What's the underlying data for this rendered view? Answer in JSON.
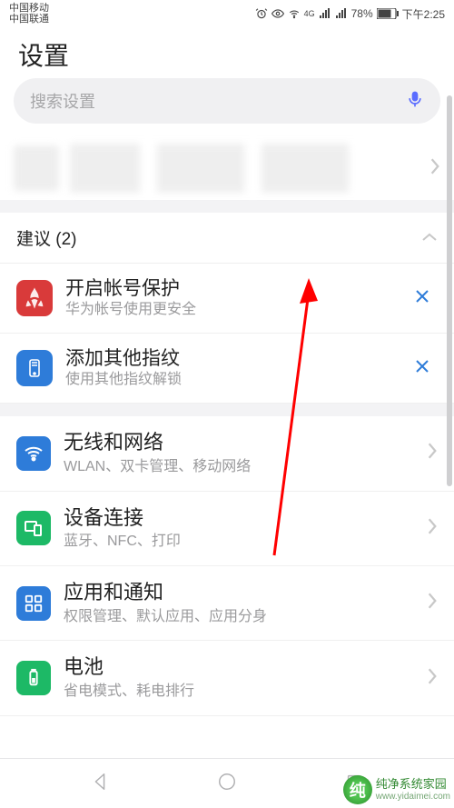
{
  "status": {
    "carrier1": "中国移动",
    "carrier2": "中国联通",
    "net_label": "4G",
    "battery_percent": "78%",
    "time": "下午2:25"
  },
  "header": {
    "title": "设置"
  },
  "search": {
    "placeholder": "搜索设置"
  },
  "suggestions": {
    "header_label": "建议 (2)",
    "items": [
      {
        "title": "开启帐号保护",
        "subtitle": "华为帐号使用更安全",
        "icon": "huawei"
      },
      {
        "title": "添加其他指纹",
        "subtitle": "使用其他指纹解锁",
        "icon": "fingerprint"
      }
    ]
  },
  "settings": [
    {
      "title": "无线和网络",
      "subtitle": "WLAN、双卡管理、移动网络",
      "icon": "wifi",
      "color": "si-blue"
    },
    {
      "title": "设备连接",
      "subtitle": "蓝牙、NFC、打印",
      "icon": "device-link",
      "color": "si-green"
    },
    {
      "title": "应用和通知",
      "subtitle": "权限管理、默认应用、应用分身",
      "icon": "apps",
      "color": "si-blue2"
    },
    {
      "title": "电池",
      "subtitle": "省电模式、耗电排行",
      "icon": "battery",
      "color": "si-green"
    }
  ],
  "watermark": {
    "name": "纯净系统家园",
    "url": "www.yidaimei.com"
  }
}
